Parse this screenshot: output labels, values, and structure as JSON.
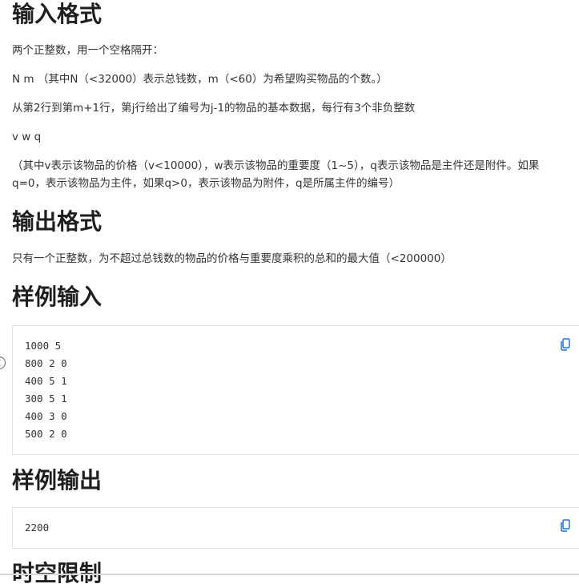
{
  "input_format": {
    "heading": "输入格式",
    "lines": [
      "两个正整数，用一个空格隔开：",
      "N m （其中N（<32000）表示总钱数，m（<60）为希望购买物品的个数。）",
      "从第2行到第m+1行，第j行给出了编号为j-1的物品的基本数据，每行有3个非负整数",
      "v w q",
      "（其中v表示该物品的价格（v<10000），w表示该物品的重要度（1~5），q表示该物品是主件还是附件。如果q=0，表示该物品为主件，如果q>0，表示该物品为附件，q是所属主件的编号）"
    ]
  },
  "output_format": {
    "heading": "输出格式",
    "text": "只有一个正整数，为不超过总钱数的物品的价格与重要度乘积的总和的最大值（<200000）"
  },
  "sample_input": {
    "heading": "样例输入",
    "code": "1000 5\n800 2 0\n400 5 1\n300 5 1\n400 3 0\n500 2 0"
  },
  "sample_output": {
    "heading": "样例输出",
    "code": "2200"
  },
  "time_limit": {
    "heading": "时空限制"
  },
  "accent_color": "#1a73e8"
}
